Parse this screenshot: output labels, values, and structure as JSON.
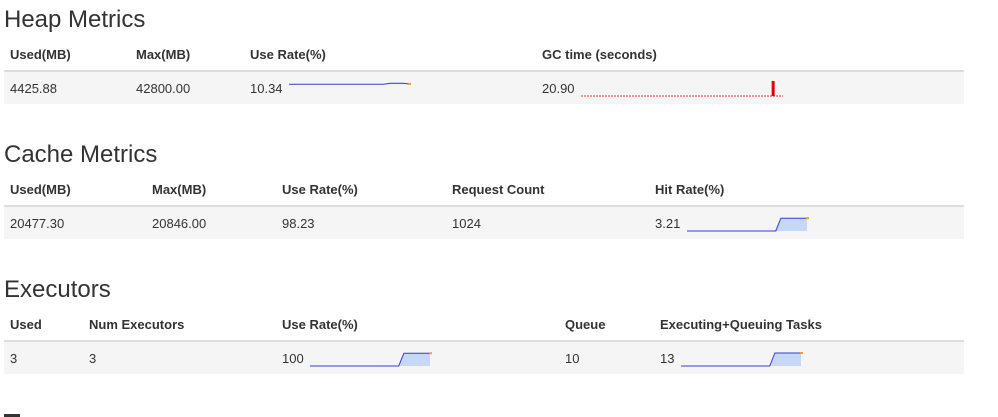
{
  "heap": {
    "title": "Heap Metrics",
    "headers": [
      "Used(MB)",
      "Max(MB)",
      "Use Rate(%)",
      "GC time (seconds)"
    ],
    "row": {
      "used": "4425.88",
      "max": "42800.00",
      "use_rate": "10.34",
      "gc_time": "20.90"
    },
    "use_rate_trend": [
      10,
      10,
      10,
      10,
      10,
      10,
      10,
      10,
      10,
      10,
      10,
      10,
      10,
      10,
      10,
      10,
      11,
      11,
      11,
      10.34
    ],
    "gc_time_trend": [
      0,
      0,
      0,
      0,
      0,
      0,
      0,
      0,
      0,
      0,
      0,
      0,
      0,
      0,
      0,
      0,
      0,
      0,
      0,
      0,
      0,
      0,
      0,
      0,
      0,
      0,
      0,
      0,
      0,
      0,
      0,
      0,
      0,
      0,
      0,
      0,
      0,
      0,
      0,
      1,
      0,
      0
    ]
  },
  "cache": {
    "title": "Cache Metrics",
    "headers": [
      "Used(MB)",
      "Max(MB)",
      "Use Rate(%)",
      "Request Count",
      "Hit Rate(%)"
    ],
    "row": {
      "used": "20477.30",
      "max": "20846.00",
      "use_rate": "98.23",
      "request_count": "1024",
      "hit_rate": "3.21"
    },
    "hit_rate_trend": [
      0,
      0,
      0,
      0,
      0,
      0,
      0,
      0,
      0,
      0,
      0,
      0,
      0,
      0,
      0,
      0,
      0,
      0,
      3.21,
      3.21,
      3.21,
      3.21,
      3.21,
      3.21
    ]
  },
  "executors": {
    "title": "Executors",
    "headers": [
      "Used",
      "Num Executors",
      "Use Rate(%)",
      "Queue",
      "Executing+Queuing Tasks"
    ],
    "row": {
      "used": "3",
      "num_executors": "3",
      "use_rate": "100",
      "queue": "10",
      "tasks": "13"
    },
    "use_rate_trend": [
      0,
      0,
      0,
      0,
      0,
      0,
      0,
      0,
      0,
      0,
      0,
      0,
      0,
      0,
      0,
      0,
      0,
      0,
      100,
      100,
      100,
      100,
      100,
      100
    ],
    "tasks_trend": [
      0,
      0,
      0,
      0,
      0,
      0,
      0,
      0,
      0,
      0,
      0,
      0,
      0,
      0,
      0,
      0,
      0,
      0,
      13,
      13,
      13,
      13,
      13,
      13
    ]
  },
  "colors": {
    "line": "#3b3bd1",
    "fill": "#c7d7f7",
    "marker": "#f0a030",
    "gc_line": "#ee3333",
    "gc_bar": "#dd0000"
  }
}
